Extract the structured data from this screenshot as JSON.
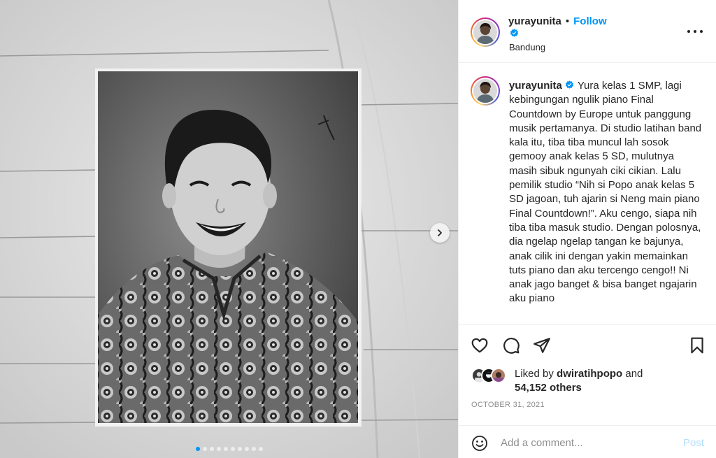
{
  "post": {
    "username": "yurayunita",
    "follow_label": "Follow",
    "separator": "•",
    "location": "Bandung"
  },
  "media": {
    "type": "black-and-white photo of a smiling child pinned on paper",
    "carousel_count": 10,
    "carousel_active_index": 0,
    "next_icon": "chevron-right-icon"
  },
  "caption": {
    "username": "yurayunita",
    "text": "Yura kelas 1 SMP, lagi kebingungan ngulik piano Final Countdown by Europe untuk panggung musik pertamanya. Di studio latihan band kala itu, tiba tiba muncul lah sosok gemooy anak kelas 5 SD, mulutnya masih sibuk ngunyah ciki cikian. Lalu pemilik studio “Nih si Popo anak kelas 5 SD jagoan, tuh ajarin si Neng main piano Final Countdown!”. Aku cengo, siapa nih tiba tiba masuk studio. Dengan polosnya, dia ngelap ngelap tangan ke bajunya, anak cilik ini dengan yakin memainkan tuts piano dan aku tercengo cengo!! Ni anak jago banget & bisa banget ngajarin aku piano"
  },
  "actions": {
    "icons": [
      "heart-icon",
      "comment-icon",
      "share-icon",
      "bookmark-icon"
    ]
  },
  "likes": {
    "prefix": "Liked by",
    "user": "dwiratihpopo",
    "conjunction": "and",
    "others": "54,152 others"
  },
  "date": "OCTOBER 31, 2021",
  "comment": {
    "placeholder": "Add a comment...",
    "post_label": "Post"
  },
  "colors": {
    "accent": "#0095f6",
    "post_disabled": "#b2dffc",
    "muted": "#8e8e8e",
    "text": "#262626"
  }
}
